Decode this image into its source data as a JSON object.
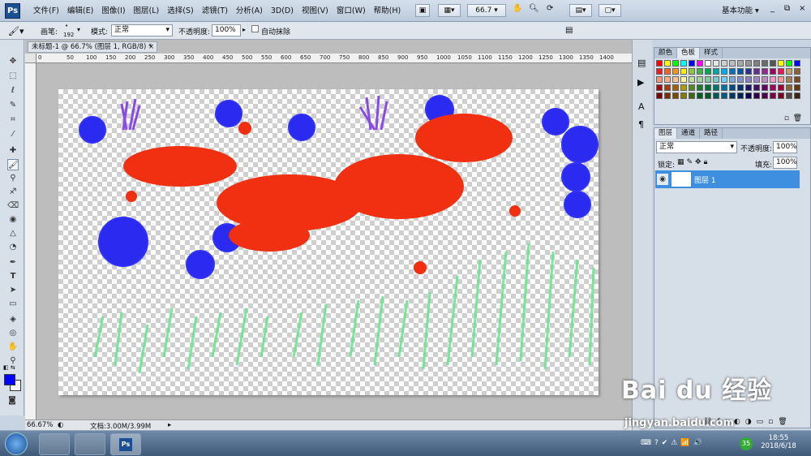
{
  "app": {
    "logo": "Ps"
  },
  "menu": [
    "文件(F)",
    "编辑(E)",
    "图像(I)",
    "图层(L)",
    "选择(S)",
    "滤镜(T)",
    "分析(A)",
    "3D(D)",
    "视图(V)",
    "窗口(W)",
    "帮助(H)"
  ],
  "menubar_right": {
    "zoom": "66.7",
    "workspace": "基本功能",
    "minimize": "_",
    "restore": "⧉",
    "close": "×"
  },
  "options": {
    "brush_label": "画笔:",
    "brush_size": "192",
    "mode_label": "模式:",
    "mode_value": "正常",
    "opacity_label": "不透明度:",
    "opacity_value": "100%",
    "auto_erase_label": "自动抹除"
  },
  "document": {
    "tab_title": "未标题-1 @ 66.7% (图层 1, RGB/8) *"
  },
  "ruler": {
    "h_labels": [
      "0",
      "50",
      "100",
      "150",
      "200",
      "250",
      "300",
      "350",
      "400",
      "450",
      "500",
      "550",
      "600",
      "650",
      "700",
      "750",
      "800",
      "850",
      "900",
      "950",
      "1000",
      "1050",
      "1100",
      "1150",
      "1200",
      "1250",
      "1300",
      "1350",
      "1400"
    ]
  },
  "status": {
    "zoom": "66.67%",
    "doc_size": "文档:3.00M/3.99M"
  },
  "swatch_panel": {
    "tabs": [
      "颜色",
      "色板",
      "样式"
    ],
    "active": 1
  },
  "swatch_colors": [
    "#ff0000",
    "#ffff00",
    "#00ff00",
    "#00ffff",
    "#0000ff",
    "#ff00ff",
    "#ffffff",
    "#e6e6e6",
    "#d0d0d0",
    "#bdbdbd",
    "#a8a8a8",
    "#959595",
    "#808080",
    "#6b6b6b",
    "#565656",
    "#ffff00",
    "#00ff00",
    "#0000ff",
    "#ee1c24",
    "#f26522",
    "#f7941d",
    "#fff200",
    "#8dc63f",
    "#39b54a",
    "#00a651",
    "#00a99d",
    "#00aeef",
    "#0072bc",
    "#0054a6",
    "#2e3192",
    "#662d91",
    "#92278f",
    "#9e005d",
    "#ed145b",
    "#c69c6d",
    "#8c6239",
    "#f69679",
    "#f9ad81",
    "#fdc689",
    "#fff799",
    "#c4df9b",
    "#a3d39c",
    "#82ca9c",
    "#7accc8",
    "#6dcff6",
    "#7da7d9",
    "#8393ca",
    "#8781bd",
    "#a186be",
    "#bd8cbf",
    "#f49ac2",
    "#f6989d",
    "#a67c52",
    "#754c24",
    "#9e0b0f",
    "#a0410d",
    "#a36209",
    "#aba000",
    "#598527",
    "#1a7b30",
    "#007236",
    "#00746b",
    "#0076a3",
    "#004b80",
    "#003471",
    "#1b1464",
    "#440e62",
    "#630460",
    "#9e005d",
    "#9e0039",
    "#8c6239",
    "#603913",
    "#790000",
    "#7b2e00",
    "#7d4900",
    "#827b00",
    "#406618",
    "#005e20",
    "#005826",
    "#005952",
    "#005b7f",
    "#003663",
    "#002157",
    "#0d004c",
    "#32004b",
    "#4b0049",
    "#7b0046",
    "#7a0026",
    "#534741",
    "#3c2415"
  ],
  "layers_panel": {
    "tabs": [
      "图层",
      "通道",
      "路径"
    ],
    "blend_mode": "正常",
    "opacity_label": "不透明度:",
    "opacity_value": "100%",
    "lock_label": "锁定:",
    "fill_label": "填充:",
    "fill_value": "100%",
    "layer_name": "图层 1"
  },
  "taskbar": {
    "time": "18:55",
    "date": "2018/6/18",
    "badge": "35"
  },
  "watermark": {
    "line1": "Bai du 经验",
    "line2": "jingyan.baidu.com"
  }
}
